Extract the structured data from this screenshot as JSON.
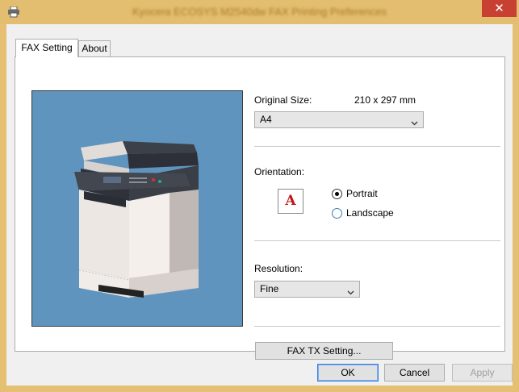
{
  "window": {
    "title": "Kyocera ECOSYS M2540dw FAX Printing Preferences",
    "close_glyph": "✕",
    "accent_color": "#e5bf72"
  },
  "tabs": [
    {
      "label": "FAX Setting",
      "selected": true
    },
    {
      "label": "About",
      "selected": false
    }
  ],
  "original_size": {
    "label": "Original Size:",
    "dimensions": "210 x 297 mm",
    "selected": "A4"
  },
  "orientation": {
    "label": "Orientation:",
    "preview_letter": "A",
    "options": [
      {
        "label": "Portrait",
        "checked": true
      },
      {
        "label": "Landscape",
        "checked": false
      }
    ]
  },
  "resolution": {
    "label": "Resolution:",
    "selected": "Fine"
  },
  "fax_tx_button": "FAX TX Setting...",
  "footer": {
    "ok": "OK",
    "cancel": "Cancel",
    "apply": "Apply"
  },
  "icons": {
    "title": "printer-icon",
    "dropdown": "chevron-down-icon"
  }
}
